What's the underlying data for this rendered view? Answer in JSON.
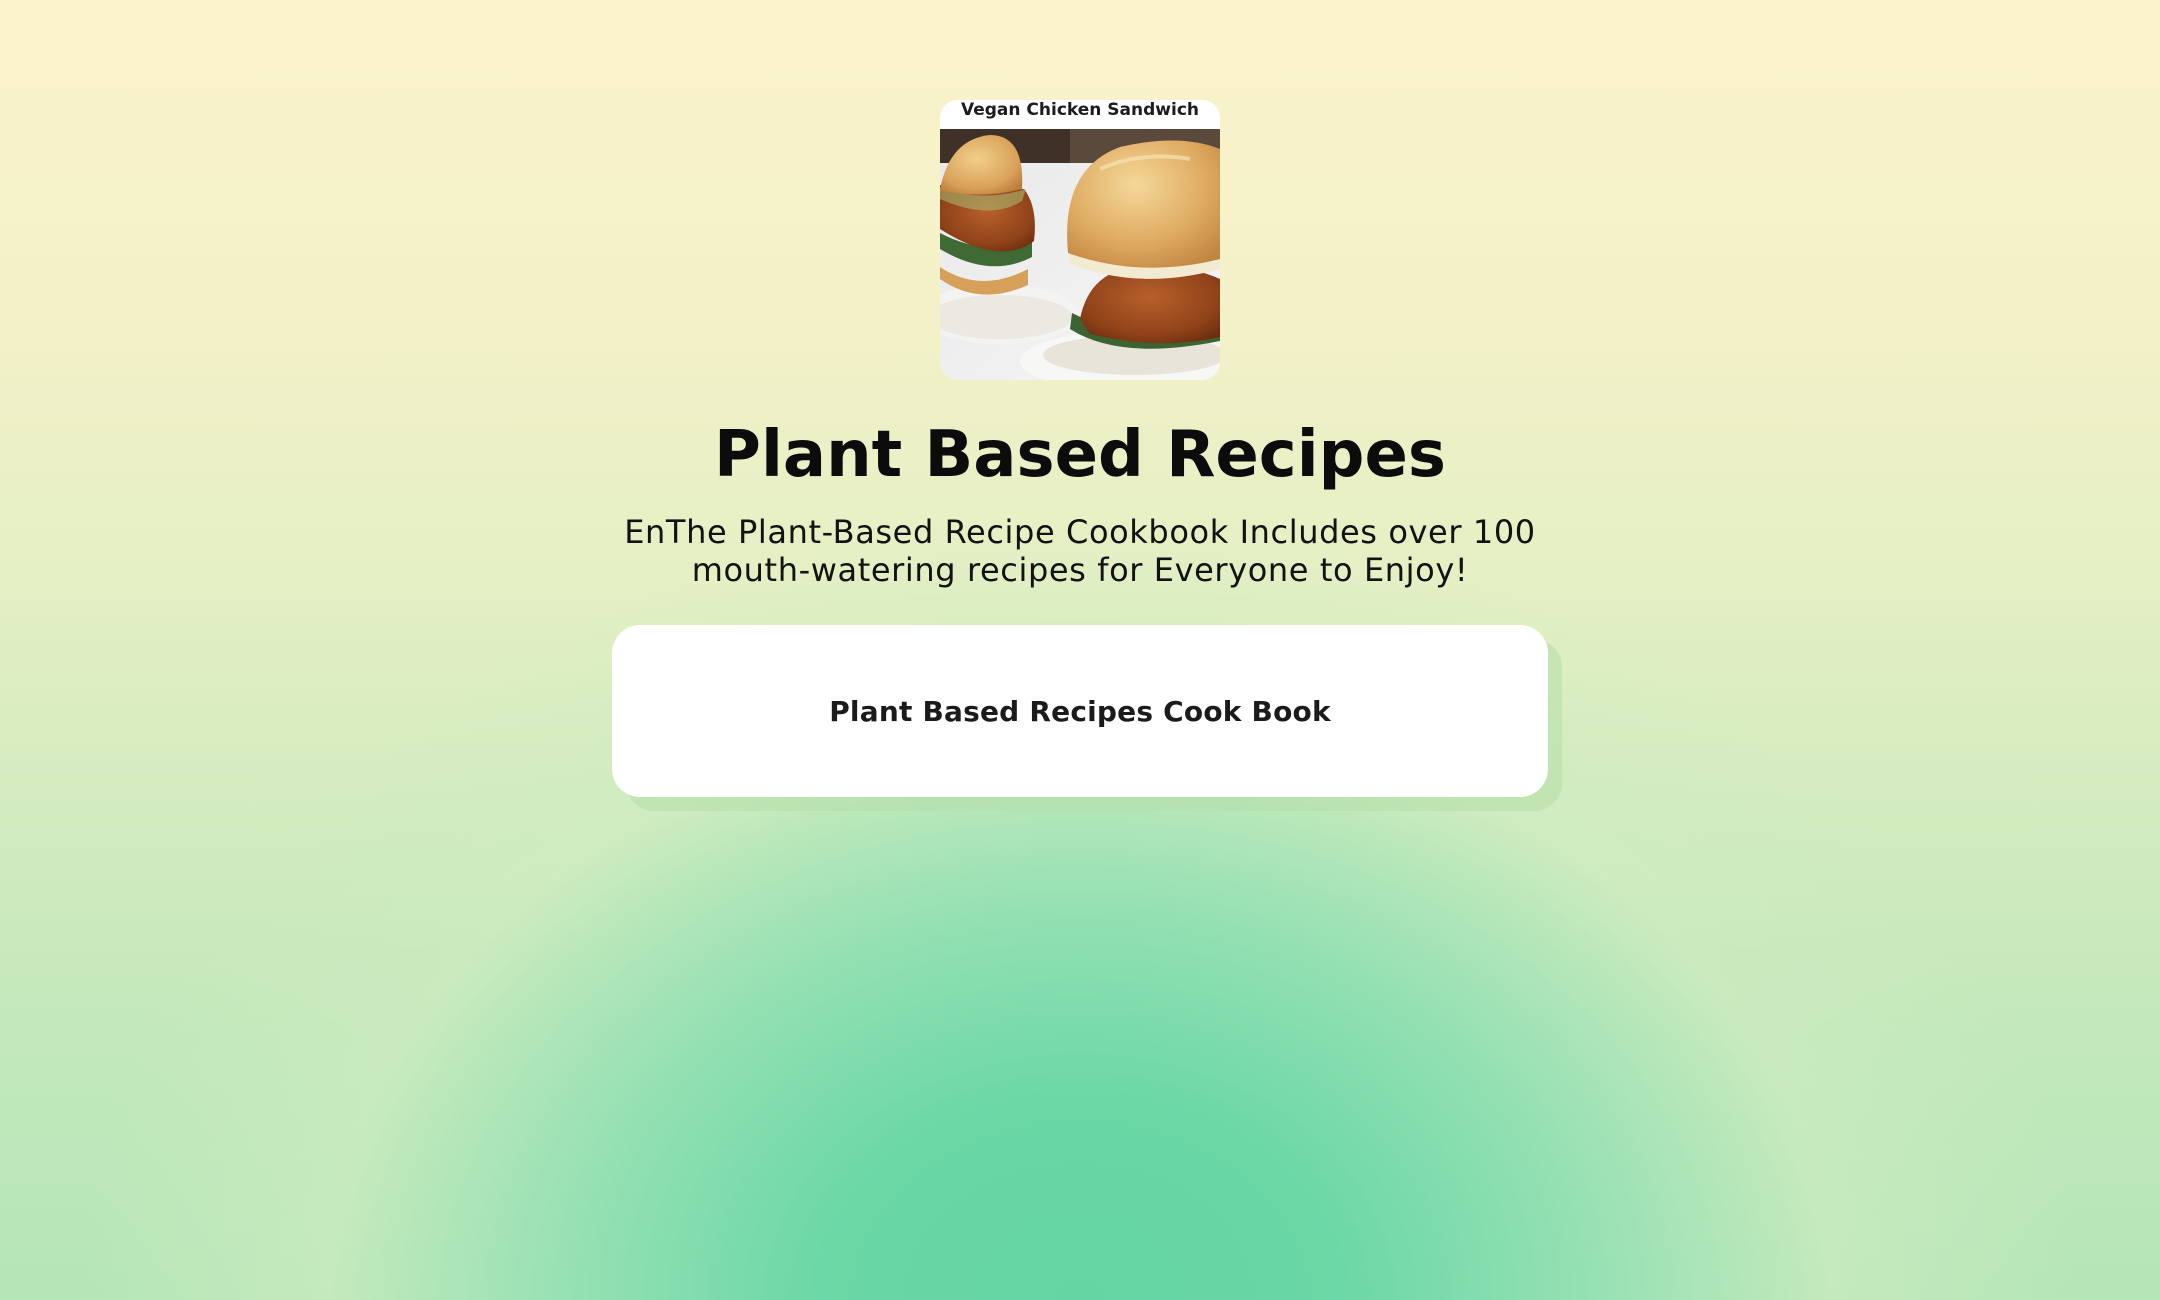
{
  "profile": {
    "image_caption": "Vegan Chicken Sandwich",
    "image_icon": "sandwich-photo",
    "title": "Plant Based Recipes",
    "bio": "EnThe Plant-Based Recipe Cookbook Includes over 100 mouth-watering recipes for Everyone to Enjoy!"
  },
  "links": [
    {
      "label": "Plant Based Recipes Cook Book"
    }
  ],
  "colors": {
    "background_top": "#fbf3cb",
    "background_bottom": "#64d6a4",
    "button": "#ffffff",
    "text": "#0c0c0c"
  }
}
